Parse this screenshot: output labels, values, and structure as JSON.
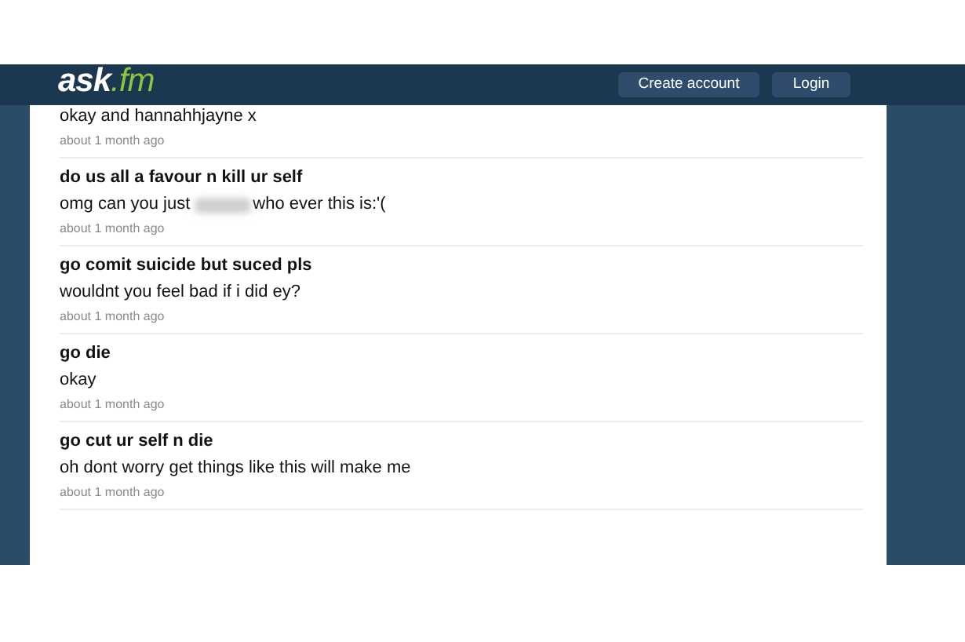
{
  "header": {
    "logo": {
      "name": "ask",
      "suffix": ".fm"
    },
    "buttons": [
      "Create account",
      "Login"
    ]
  },
  "answers": [
    {
      "answer": "okay and hannahhjayne x",
      "redacted": false,
      "time": "about 1 month ago"
    },
    {
      "question": "do us all a favour n kill ur self",
      "answer": "omg can you just",
      "redacted": true,
      "answer_after": "who ever this is:'(",
      "time": "about 1 month ago"
    },
    {
      "question": "go comit suicide but suced pls",
      "answer": "wouldnt you feel bad if i did ey?",
      "redacted": false,
      "time": "about 1 month ago"
    },
    {
      "question": "go die",
      "answer": "okay",
      "redacted": false,
      "time": "about 1 month ago"
    },
    {
      "question": "go cut ur self n die",
      "answer": "oh dont worry get things like this will make me",
      "redacted": false,
      "time": "about 1 month ago"
    }
  ]
}
